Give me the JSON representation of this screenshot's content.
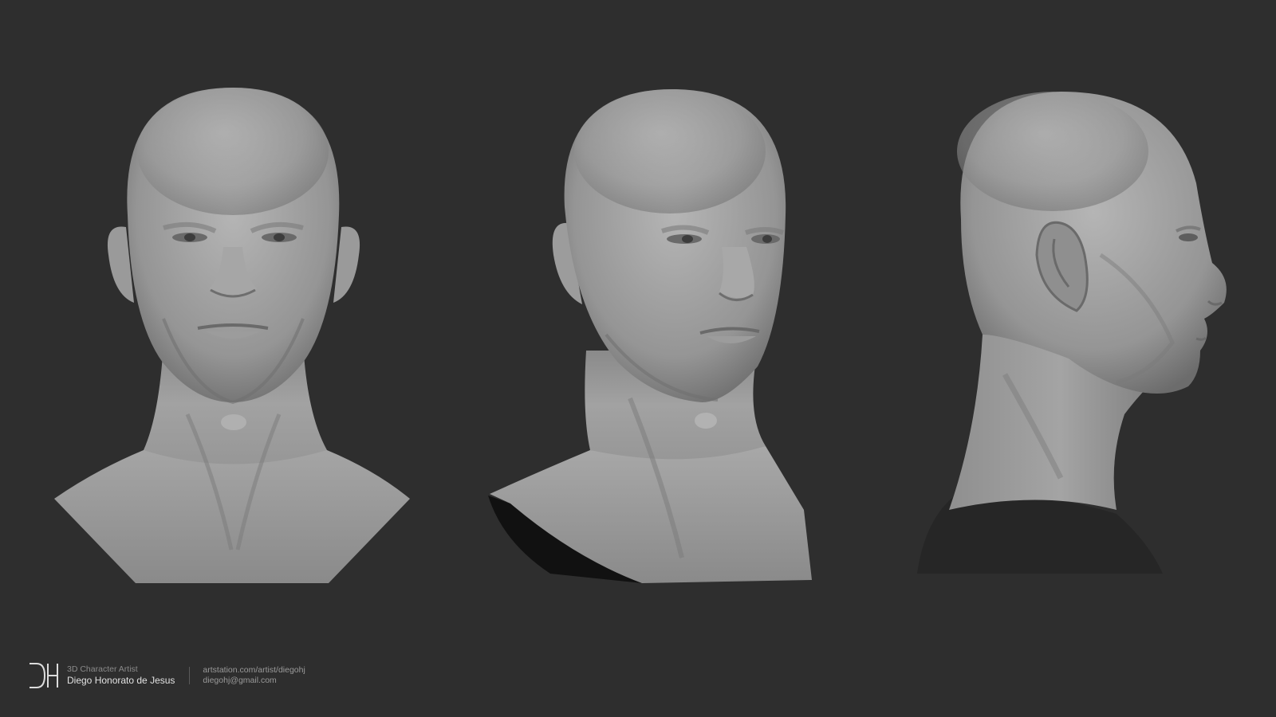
{
  "colors": {
    "background": "#2e2e2e",
    "clay_light": "#b3b3b3",
    "clay_mid": "#8e8e8e",
    "clay_dark": "#5c5c5c"
  },
  "views": [
    "front-view",
    "three-quarter-view",
    "side-view"
  ],
  "footer": {
    "logo_text": "DH",
    "role": "3D Character Artist",
    "name": "Diego Honorato de Jesus",
    "website": "artstation.com/artist/diegohj",
    "email": "diegohj@gmail.com"
  }
}
